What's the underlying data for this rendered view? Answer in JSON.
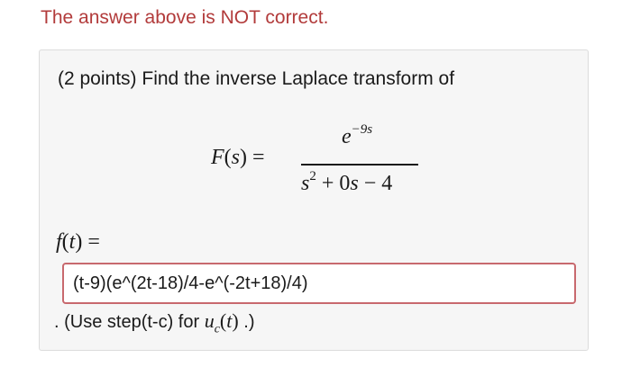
{
  "feedback": {
    "message": "The answer above is NOT correct."
  },
  "problem": {
    "prompt": "(2 points) Find the inverse Laplace transform of",
    "equation": {
      "function_name": "F",
      "variable": "s",
      "equals": "=",
      "numerator_base": "e",
      "numerator_exponent": "−9s",
      "denominator_term1_base": "s",
      "denominator_term1_exponent": "2",
      "denominator_plus": "+",
      "denominator_term2_coef": "0",
      "denominator_term2_var": "s",
      "denominator_minus": "−",
      "denominator_term3": "4"
    },
    "answer_label": {
      "function_name": "f",
      "variable": "t",
      "equals": "="
    },
    "answer": {
      "value": "(t-9)(e^(2t-18)/4-e^(-2t+18)/4)",
      "border_color": "#c8696e"
    },
    "hint": {
      "prefix": ". (Use step(t-c) for ",
      "math_fn": "u",
      "math_sub": "c",
      "math_arg": "t",
      "suffix": " .)"
    }
  },
  "colors": {
    "feedback_text": "#b23b3b",
    "card_background": "#f6f6f6"
  }
}
